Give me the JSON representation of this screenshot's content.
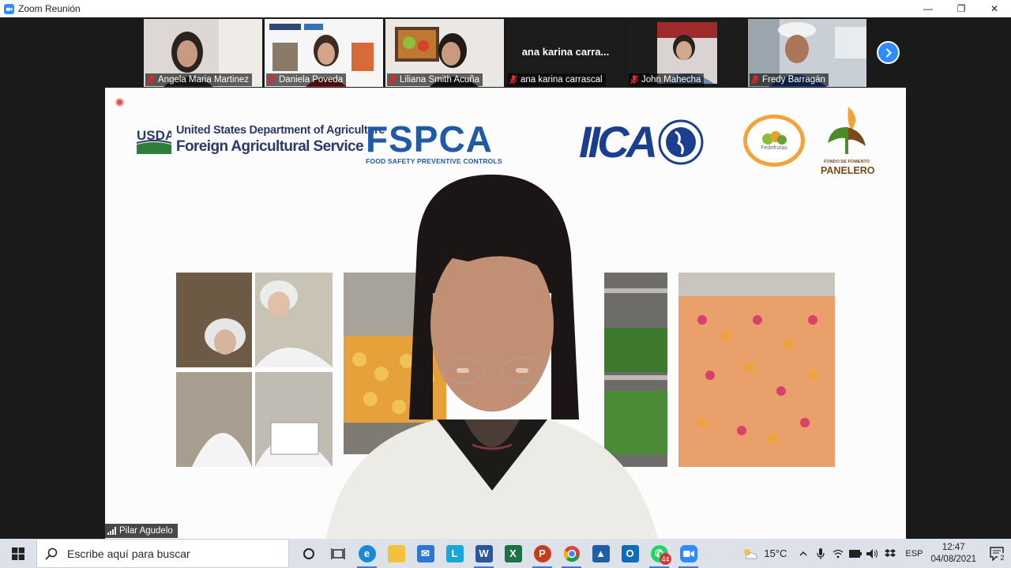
{
  "window": {
    "title": "Zoom Reunión",
    "controls": {
      "minimize": "—",
      "restore": "❐",
      "close": "✕"
    }
  },
  "gallery": {
    "participants": [
      {
        "name": "Angela Maria Martinez",
        "muted": true,
        "video": true
      },
      {
        "name": "Daniela Poveda",
        "muted": true,
        "video": true
      },
      {
        "name": "Liliana Smith Acuña",
        "muted": true,
        "video": true
      },
      {
        "name": "ana karina carrascal",
        "display_name": "ana karina carra...",
        "muted": true,
        "video": false
      },
      {
        "name": "John Mahecha",
        "muted": true,
        "video": true
      },
      {
        "name": "Fredy Barragán",
        "muted": true,
        "video": true
      }
    ]
  },
  "stage": {
    "speaker_name": "Pilar Agudelo",
    "slide": {
      "usda_mark": "USDA",
      "usda_line1": "United States Department of Agriculture",
      "usda_line2": "Foreign Agricultural Service",
      "fspca_logo": "FSPCA",
      "fspca_tagline": "FOOD SAFETY PREVENTIVE CONTROLS",
      "iica_logo": "IICA",
      "fede_logo": "Fedefrutas",
      "panelero_small": "FONDO DE FOMENTO",
      "panelero_big": "PANELERO"
    }
  },
  "taskbar": {
    "search_placeholder": "Escribe aquí para buscar",
    "whatsapp_badge": "44",
    "temperature": "15°C",
    "language": "ESP",
    "time": "12:47",
    "date": "04/08/2021",
    "notification_count": "2"
  },
  "colors": {
    "zoom_blue": "#2d8cff",
    "muted_red": "#e02828",
    "stage_bg": "#fcfcfc"
  }
}
